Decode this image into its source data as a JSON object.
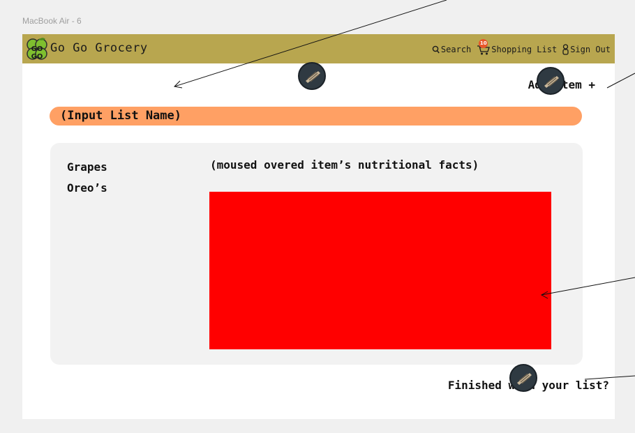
{
  "frame_label": "MacBook Air - 6",
  "header": {
    "brand": "Go Go Grocery",
    "logo_text": "GO GO",
    "nav": {
      "search": "Search",
      "shopping_list": "Shopping List",
      "cart_count": "10",
      "sign_out": "Sign Out"
    }
  },
  "actions": {
    "add_item": "Add Item +",
    "finished": "Finished with your list?"
  },
  "list_name_placeholder": "(Input List Name)",
  "items": [
    "Grapes",
    "Oreo’s"
  ],
  "facts_title": "(moused overed item’s nutritional facts)",
  "colors": {
    "header_bg": "#b8a64f",
    "list_name_bg": "#ffa064",
    "facts_box": "#ff0000",
    "panel_bg": "#f2f2f2",
    "logo_green": "#7fbf2f"
  },
  "icons": [
    "search-icon",
    "cart-icon",
    "user-icon",
    "logo-icon",
    "cursor-marker-icon"
  ]
}
